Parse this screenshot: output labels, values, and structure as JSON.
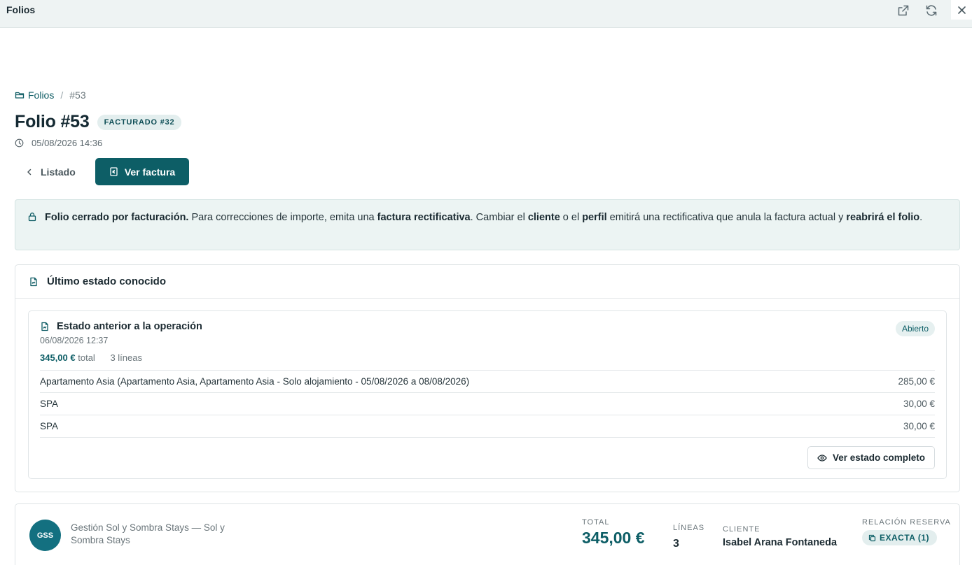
{
  "window": {
    "title": "Folios"
  },
  "breadcrumb": {
    "root": "Folios",
    "separator": "/",
    "current": "#53"
  },
  "header": {
    "title": "Folio #53",
    "badge": "FACTURADO #32",
    "datetime": "05/08/2026 14:36"
  },
  "actions": {
    "back_label": "Listado",
    "invoice_label": "Ver factura"
  },
  "alert": {
    "part1_bold": "Folio cerrado por facturación.",
    "part2": " Para correcciones de importe, emita una ",
    "part3_bold": "factura rectificativa",
    "part4": ". Cambiar el ",
    "part5_bold": "cliente",
    "part6": " o el ",
    "part7_bold": "perfil",
    "part8": " emitirá una rectificativa que anula la factura actual y ",
    "part9_bold": "reabrirá el folio",
    "part10": "."
  },
  "last_state": {
    "heading": "Último estado conocido",
    "entry": {
      "title": "Estado anterior a la operación",
      "datetime": "06/08/2026 12:37",
      "status": "Abierto",
      "total_amount": "345,00 €",
      "total_label": "total",
      "lines_count": "3 líneas",
      "lines": [
        {
          "description": "Apartamento Asia (Apartamento Asia, Apartamento Asia - Solo alojamiento - 05/08/2026 a 08/08/2026)",
          "amount": "285,00 €"
        },
        {
          "description": "SPA",
          "amount": "30,00 €"
        },
        {
          "description": "SPA",
          "amount": "30,00 €"
        }
      ],
      "view_full_label": "Ver estado completo"
    }
  },
  "summary": {
    "avatar_initials": "GSS",
    "organization": "Gestión Sol y Sombra Stays — Sol y Sombra Stays",
    "total_label": "TOTAL",
    "total_value": "345,00 €",
    "lines_label": "LÍNEAS",
    "lines_value": "3",
    "client_label": "CLIENTE",
    "client_value": "Isabel Arana Fontaneda",
    "relation_label": "RELACIÓN RESERVA",
    "relation_value": "EXACTA (1)"
  },
  "colors": {
    "accent": "#0d5e66",
    "alert_bg": "#ecf4f3",
    "badge_bg": "#e3eeee",
    "avatar_bg": "#137080"
  },
  "icons": {
    "external": "external-link-icon",
    "refresh": "refresh-icon",
    "close": "close-icon",
    "folder": "folder-icon",
    "clock": "clock-icon",
    "chevron": "chevron-left-icon",
    "invoice": "invoice-icon",
    "lock": "lock-icon",
    "document": "document-icon",
    "eye": "eye-icon",
    "copy": "copy-icon"
  }
}
